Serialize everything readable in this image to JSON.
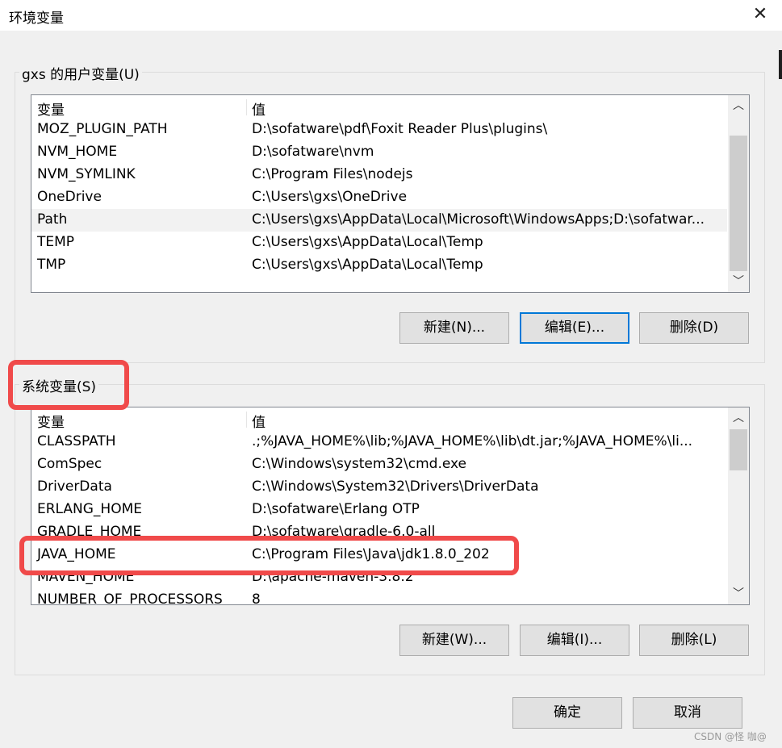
{
  "window": {
    "title": "环境变量",
    "close_glyph": "✕"
  },
  "user_group": {
    "label": "gxs 的用户变量(U)",
    "columns": {
      "name": "变量",
      "value": "值"
    },
    "rows": [
      {
        "name": "MOZ_PLUGIN_PATH",
        "value": "D:\\sofatware\\pdf\\Foxit Reader Plus\\plugins\\"
      },
      {
        "name": "NVM_HOME",
        "value": "D:\\sofatware\\nvm"
      },
      {
        "name": "NVM_SYMLINK",
        "value": "C:\\Program Files\\nodejs"
      },
      {
        "name": "OneDrive",
        "value": "C:\\Users\\gxs\\OneDrive"
      },
      {
        "name": "Path",
        "value": "C:\\Users\\gxs\\AppData\\Local\\Microsoft\\WindowsApps;D:\\sofatwar..."
      },
      {
        "name": "TEMP",
        "value": "C:\\Users\\gxs\\AppData\\Local\\Temp"
      },
      {
        "name": "TMP",
        "value": "C:\\Users\\gxs\\AppData\\Local\\Temp"
      }
    ],
    "buttons": {
      "new": "新建(N)...",
      "edit": "编辑(E)...",
      "delete": "删除(D)"
    }
  },
  "system_group": {
    "label": "系统变量(S)",
    "columns": {
      "name": "变量",
      "value": "值"
    },
    "rows": [
      {
        "name": "CLASSPATH",
        "value": ".;%JAVA_HOME%\\lib;%JAVA_HOME%\\lib\\dt.jar;%JAVA_HOME%\\li..."
      },
      {
        "name": "ComSpec",
        "value": "C:\\Windows\\system32\\cmd.exe"
      },
      {
        "name": "DriverData",
        "value": "C:\\Windows\\System32\\Drivers\\DriverData"
      },
      {
        "name": "ERLANG_HOME",
        "value": "D:\\sofatware\\Erlang OTP"
      },
      {
        "name": "GRADLE_HOME",
        "value": "D:\\sofatware\\gradle-6.0-all"
      },
      {
        "name": "JAVA_HOME",
        "value": "C:\\Program Files\\Java\\jdk1.8.0_202"
      },
      {
        "name": "MAVEN_HOME",
        "value": "D:\\apache-maven-3.8.2"
      },
      {
        "name": "NUMBER_OF_PROCESSORS",
        "value": "8"
      }
    ],
    "buttons": {
      "new": "新建(W)...",
      "edit": "编辑(I)...",
      "delete": "删除(L)"
    }
  },
  "footer": {
    "ok": "确定",
    "cancel": "取消"
  },
  "watermark": "CSDN @怪 咖@",
  "colors": {
    "highlight": "#f04a4a",
    "focus": "#0078d7"
  }
}
